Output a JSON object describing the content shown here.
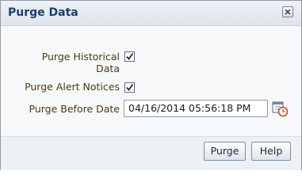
{
  "dialog": {
    "title": "Purge Data",
    "close_icon": "close-icon"
  },
  "form": {
    "purge_historical": {
      "label_line1": "Purge Historical",
      "label_line2": "Data",
      "checked": true
    },
    "purge_alerts": {
      "label": "Purge Alert Notices",
      "checked": true
    },
    "purge_before": {
      "label": "Purge Before Date",
      "value": "04/16/2014 05:56:18 PM",
      "icon": "calendar-clock-icon"
    }
  },
  "buttons": {
    "purge": "Purge",
    "help": "Help"
  },
  "colors": {
    "title": "#1c3f6e",
    "label": "#4a3b12",
    "checkmark": "#2a2a2a",
    "border": "#8c9aab"
  }
}
